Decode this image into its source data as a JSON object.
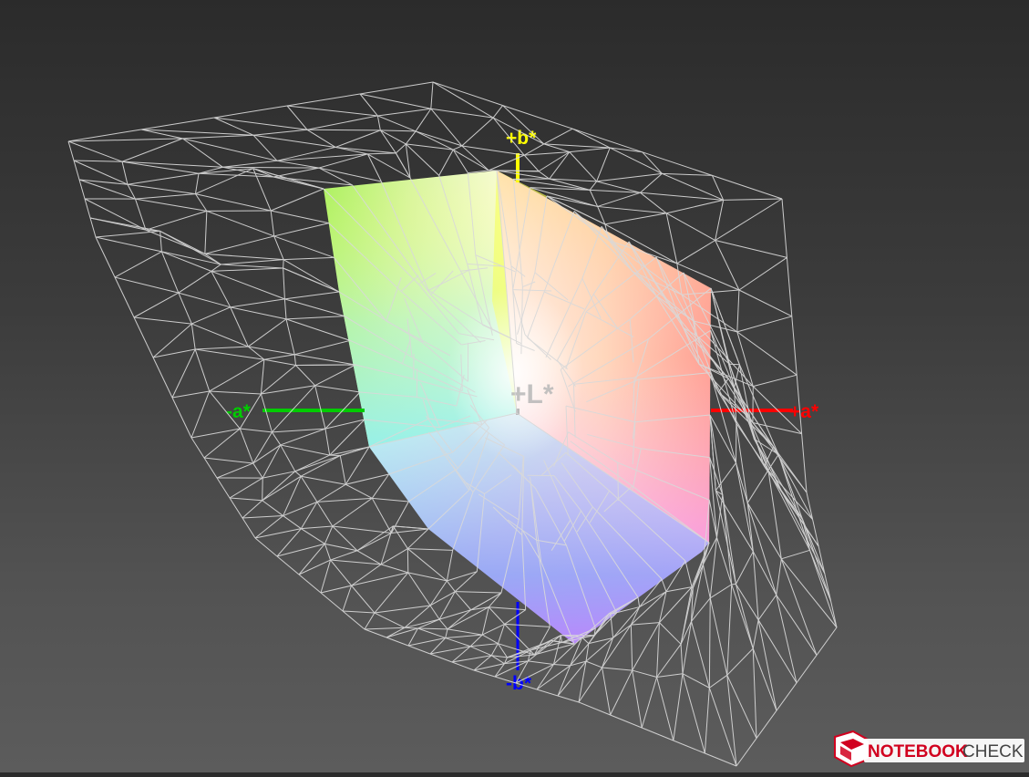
{
  "diagram": {
    "axes": {
      "plus_b": "+b*",
      "minus_b": "-b*",
      "plus_a": "+a*",
      "minus_a": "-a*",
      "plus_L": "+L*"
    },
    "colors": {
      "plus_b_axis": "#ffff00",
      "minus_b_axis": "#0000ff",
      "plus_a_axis": "#ff0000",
      "minus_a_axis": "#00cc00",
      "plus_L_label": "#b8b8b8",
      "wireframe": "#d9d9d9"
    }
  },
  "watermark": {
    "brand_prefix": "NOTEBOOK",
    "brand_suffix": "CHECK",
    "brand_color": "#d1001f",
    "logo_icon": "notebook-laptop-logo-icon"
  }
}
